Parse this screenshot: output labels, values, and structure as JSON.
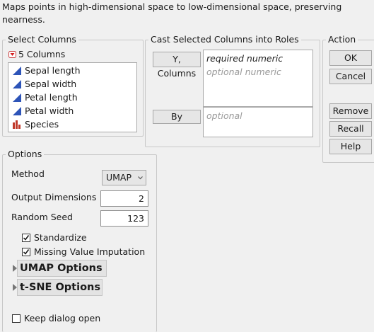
{
  "description": "Maps points in high-dimensional space to low-dimensional space, preserving nearness.",
  "select_columns": {
    "legend": "Select Columns",
    "count_label": "5 Columns",
    "columns": [
      {
        "name": "Sepal length",
        "icon": "continuous-icon"
      },
      {
        "name": "Sepal width",
        "icon": "continuous-icon"
      },
      {
        "name": "Petal length",
        "icon": "continuous-icon"
      },
      {
        "name": "Petal width",
        "icon": "continuous-icon"
      },
      {
        "name": "Species",
        "icon": "nominal-icon"
      }
    ]
  },
  "cast_roles": {
    "legend": "Cast Selected Columns into Roles",
    "y_button": "Y, Columns",
    "y_required": "required numeric",
    "y_optional": "optional numeric",
    "by_button": "By",
    "by_optional": "optional"
  },
  "action": {
    "legend": "Action",
    "ok": "OK",
    "cancel": "Cancel",
    "remove": "Remove",
    "recall": "Recall",
    "help": "Help"
  },
  "options": {
    "legend": "Options",
    "method_label": "Method",
    "method_value": "UMAP",
    "output_dimensions_label": "Output Dimensions",
    "output_dimensions_value": "2",
    "random_seed_label": "Random Seed",
    "random_seed_value": "123",
    "standardize_label": "Standardize",
    "standardize_checked": true,
    "missing_imputation_label": "Missing Value Imputation",
    "missing_imputation_checked": true,
    "umap_options_label": "UMAP Options",
    "tsne_options_label": "t-SNE Options",
    "keep_open_label": "Keep dialog open",
    "keep_open_checked": false
  },
  "colors": {
    "continuous_icon": "#2d54b8",
    "nominal_icon": "#c0392b",
    "red_disclosure": "#d62020"
  }
}
